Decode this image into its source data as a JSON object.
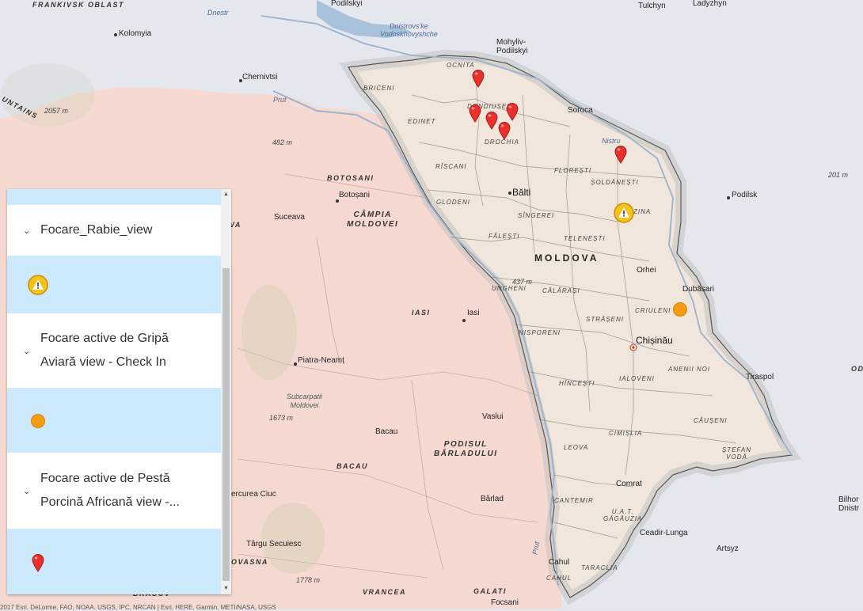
{
  "legend": {
    "layers": [
      {
        "title": "Focare_Rabie_view",
        "symbol": "warning-triangle-icon"
      },
      {
        "title_line1": "Focare active de Gripă",
        "title_line2": "Aviară view - Check In",
        "symbol": "orange-circle-icon"
      },
      {
        "title_line1": "Focare active de Pestă",
        "title_line2": "Porcină Africană view -...",
        "symbol": "red-pin-icon"
      }
    ]
  },
  "map": {
    "country_label": "MOLDOVA",
    "colors": {
      "land_md": "#f2e7dc",
      "land_ro": "#f7dad2",
      "land_ua": "#e4e6ee",
      "river": "#9ab3cf",
      "pin_red": "#e8302c",
      "marker_orange": "#f39c12",
      "warning_yellow": "#f5c318"
    },
    "cities": {
      "chisinau": "Chișinău",
      "balti": "Bălti",
      "orhei": "Orhei",
      "dubasari": "Dubăsari",
      "tiraspol": "Tiraspol",
      "comrat": "Comrat",
      "ceadir_lunga": "Ceadir-Lunga",
      "cahul": "Cahul",
      "soroca": "Soroca",
      "mohyliv": "Mohyliv-\nPodilskyi",
      "chernivtsi": "Chernivtsi",
      "kolomyia": "Kolomyia",
      "podilsk": "Podilsk",
      "tulchyn": "Tulchyn",
      "ladyzhyn": "Ladyzhyn",
      "podilskyi_top": "Podilskyi",
      "botosani": "Botoșani",
      "suceava": "Suceava",
      "iasi": "Iasi",
      "piatra_neamt": "Piatra-Neamț",
      "bacau": "Bacau",
      "vaslui": "Vaslui",
      "barlad": "Bârlad",
      "focsani": "Focsani",
      "targu_secuiesc": "Târgu Secuiesc",
      "miercurea_ciuc": "ercurea Ciuc",
      "artsyz": "Artsyz",
      "bilhorod": "Bilhor\nDnistr"
    },
    "regions": {
      "frankivsk": "FRANKIVSK\nOBLAST",
      "botosani_reg": "BOTOSANI",
      "iasi_reg": "IASI",
      "bacau_reg": "BACAU",
      "vrancea": "VRANCEA",
      "galati": "GALATI",
      "vaslui_reg": "VA",
      "covasna": "OVASNA",
      "brasov": "BRASOV",
      "untains": "UNTAINS",
      "od": "OD"
    },
    "districts": {
      "ocnita": "OCNITA",
      "briceni": "BRICENI",
      "edinet": "EDINET",
      "dondiuseni": "DONDIUSENI",
      "drochia": "DROCHIA",
      "riscani": "RÎSCANI",
      "glodeni": "GLODENI",
      "singerei": "SÎNGEREI",
      "falesti": "FĂLEȘTI",
      "floresti": "FLOREȘTI",
      "soldanesti": "ȘOLDĂNEȘTI",
      "rezina": "ZINA",
      "telenesti": "TELENEȘTI",
      "ungheni": "UNGHENI",
      "calarasi": "CĂLĂRAȘI",
      "straseni": "STRĂȘENI",
      "criuleni": "CRIULENI",
      "hincesti": "HÎNCEȘTI",
      "ialoveni": "IALOVENI",
      "anenii_noi": "ANENII NOI",
      "leova": "LEOVA",
      "cimislia": "CIMIȘLIA",
      "causeni": "CĂUȘENI",
      "stefan_voda": "ȘTEFAN\nVODĂ",
      "cantemir": "CANTEMIR",
      "utag": "U.A.T.\nGĂGĂUZIA",
      "taraclia": "TARACLIA",
      "cahul_d": "CAHUL",
      "nisporeni": "NISPORENI",
      "nistru": "Nistru"
    },
    "relief": {
      "campia": "CÂMPIA\nMOLDOVEI",
      "podisul": "PODISUL\nBÂRLADULUI",
      "subcarpatii": "Subcarpatii\nMoldovei"
    },
    "water": {
      "dnestr": "Dnestr",
      "dnistrovske": "Dnistrovs'ke\nVodoskhovyshche",
      "prut_n": "Prut",
      "prut_s": "Prut"
    },
    "elevations": {
      "e2057": "2057 m",
      "e482": "482 m",
      "e437": "437 m",
      "e201": "201 m",
      "e1673": "1673 m",
      "e1778": "1778 m"
    },
    "attribution": "2017 Esri, DeLorme, FAO, NOAA, USGS, IPC, NRCAN | Esri, HERE, Garmin, METI/NASA, USGS"
  }
}
